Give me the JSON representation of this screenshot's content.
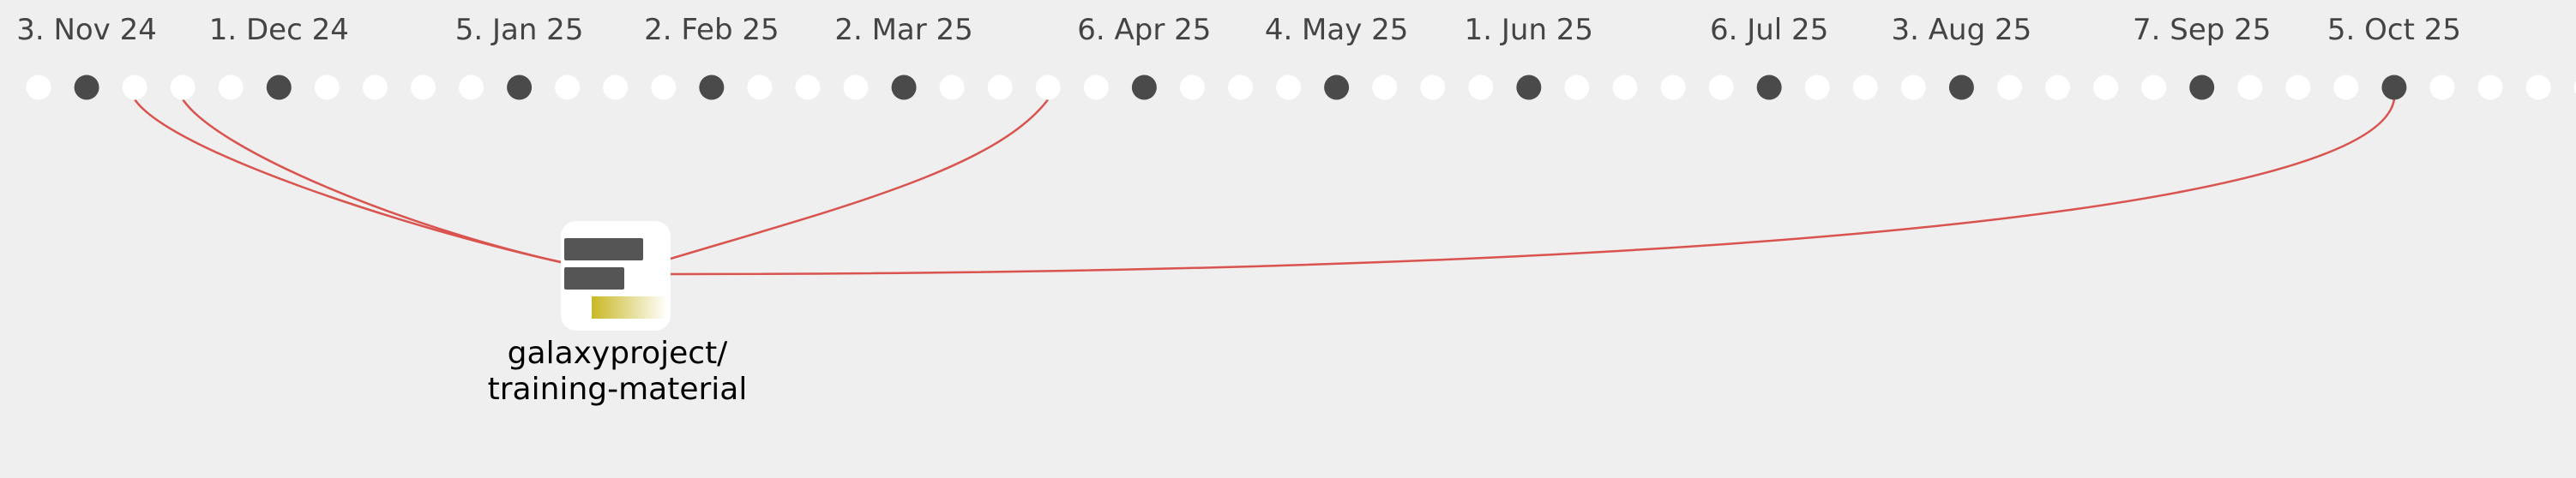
{
  "timeline": {
    "dot_count": 54,
    "highlighted_dot_indices": [
      1,
      5,
      10,
      14,
      18,
      23,
      27,
      31,
      36,
      40,
      45,
      49
    ],
    "labels": [
      {
        "dot": 1,
        "text": "3. Nov 24"
      },
      {
        "dot": 5,
        "text": "1. Dec 24"
      },
      {
        "dot": 10,
        "text": "5. Jan 25"
      },
      {
        "dot": 14,
        "text": "2. Feb 25"
      },
      {
        "dot": 18,
        "text": "2. Mar 25"
      },
      {
        "dot": 23,
        "text": "6. Apr 25"
      },
      {
        "dot": 27,
        "text": "4. May 25"
      },
      {
        "dot": 31,
        "text": "1. Jun 25"
      },
      {
        "dot": 36,
        "text": "6. Jul 25"
      },
      {
        "dot": 40,
        "text": "3. Aug 25"
      },
      {
        "dot": 45,
        "text": "7. Sep 25"
      },
      {
        "dot": 49,
        "text": "5. Oct 25"
      }
    ],
    "linked_dot_indices": [
      2,
      3,
      21,
      49
    ]
  },
  "repository": {
    "name_line1": "galaxyproject/",
    "name_line2": "training-material",
    "icon": "repository-bars-icon"
  },
  "colors": {
    "background": "#efefef",
    "dot_default": "#ffffff",
    "dot_highlight": "#4a4a4a",
    "link_line": "#d9534f",
    "icon_bar_dark": "#555555",
    "icon_bar_accent": "#c9b825"
  }
}
